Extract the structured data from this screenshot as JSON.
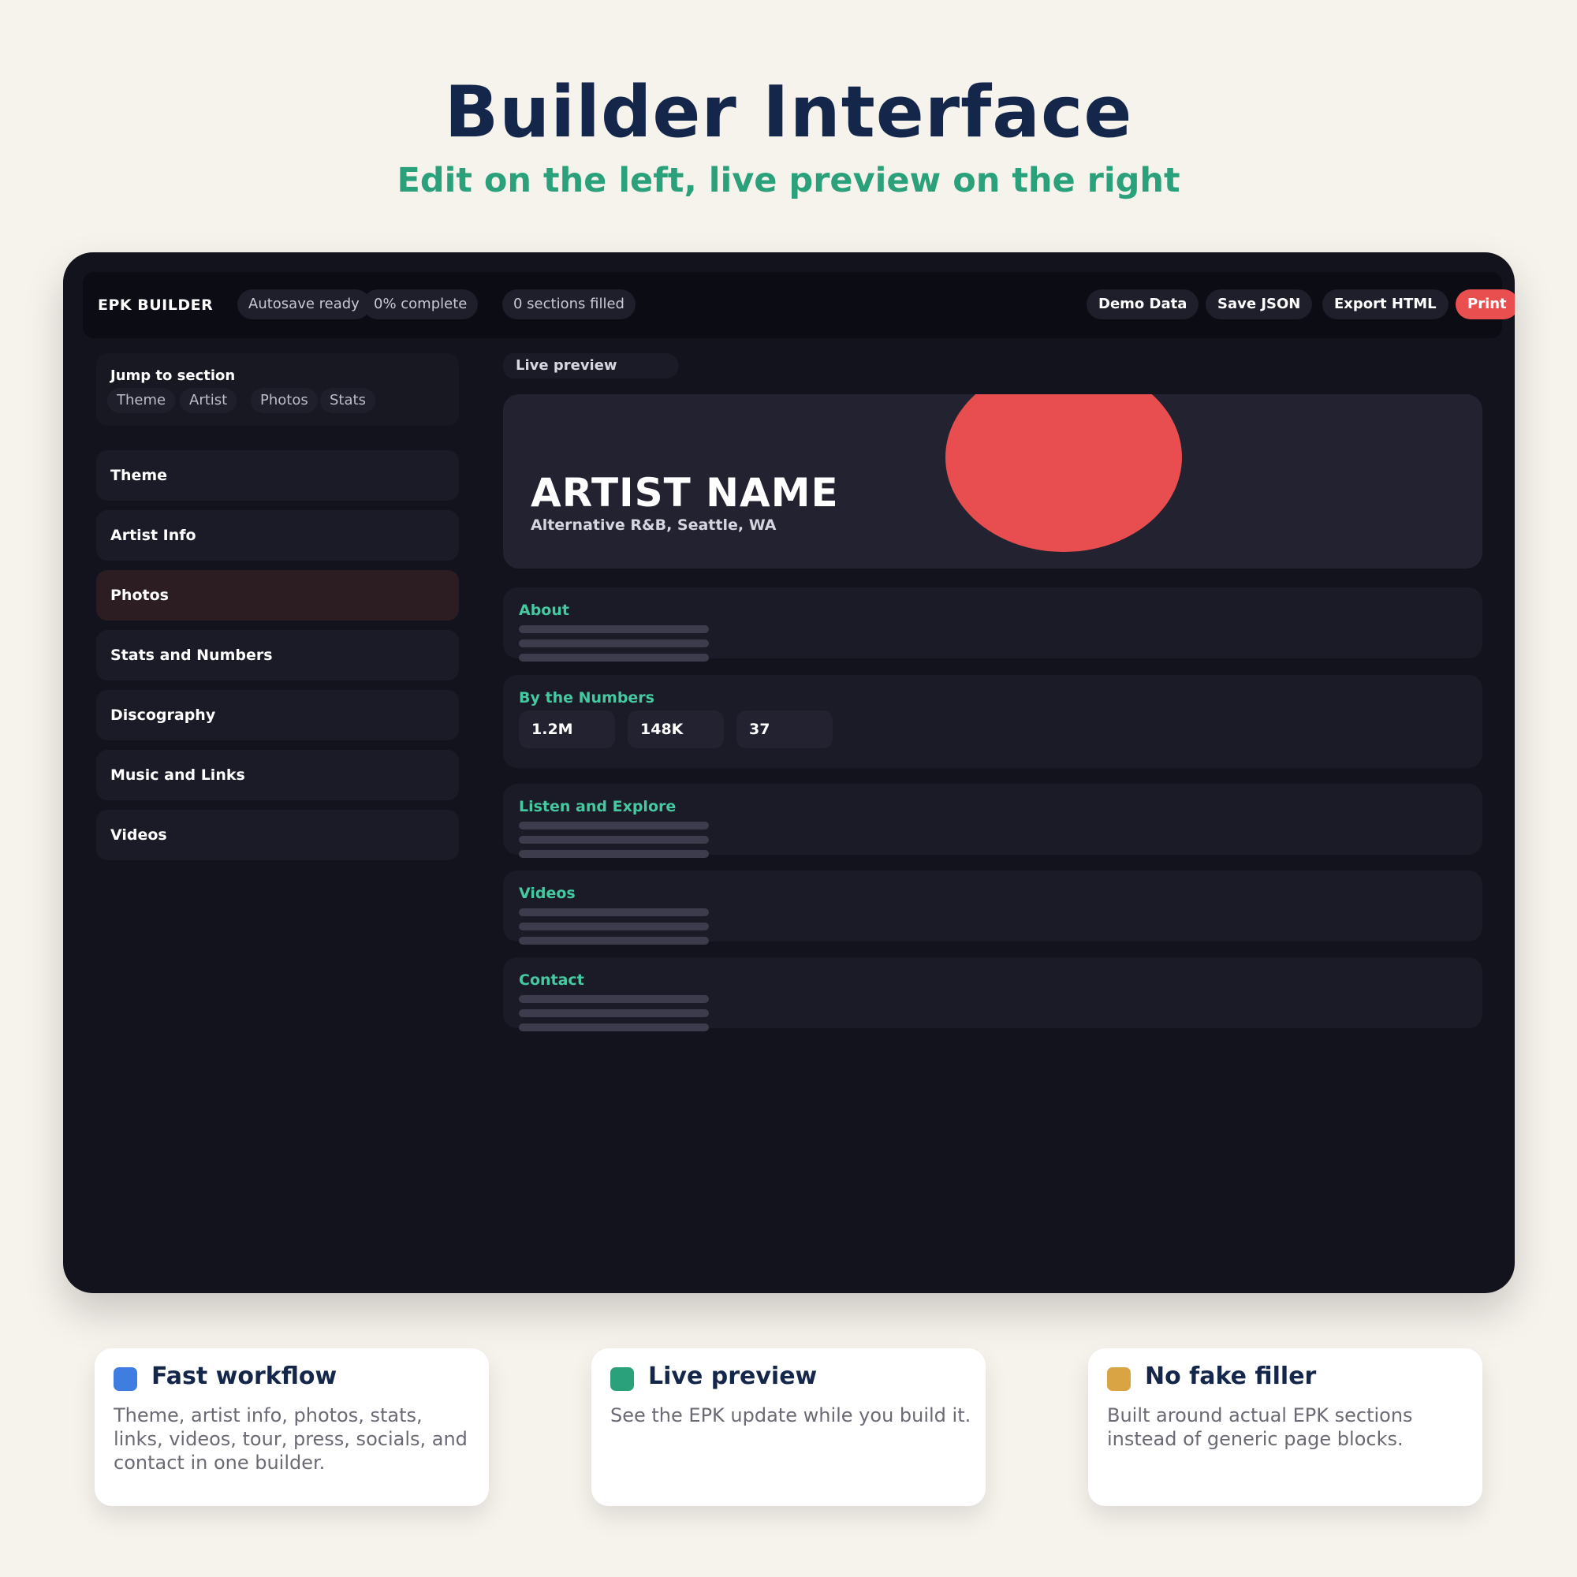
{
  "hero": {
    "title": "Builder Interface",
    "subtitle": "Edit on the left, live preview on the right"
  },
  "topbar": {
    "brand": "EPK BUILDER",
    "status_pills": [
      "Autosave ready",
      "0% complete",
      "0 sections filled"
    ],
    "buttons": {
      "demo": "Demo Data",
      "save": "Save JSON",
      "export": "Export HTML",
      "print": "Print"
    }
  },
  "sidebar": {
    "jump_title": "Jump to section",
    "jump_links": [
      "Theme",
      "Artist",
      "Photos",
      "Stats"
    ],
    "items": [
      {
        "label": "Theme",
        "active": false
      },
      {
        "label": "Artist Info",
        "active": false
      },
      {
        "label": "Photos",
        "active": true
      },
      {
        "label": "Stats and Numbers",
        "active": false
      },
      {
        "label": "Discography",
        "active": false
      },
      {
        "label": "Music and Links",
        "active": false
      },
      {
        "label": "Videos",
        "active": false
      }
    ]
  },
  "preview": {
    "label": "Live preview",
    "artist_name": "ARTIST NAME",
    "artist_meta": "Alternative R&B, Seattle, WA",
    "sections": {
      "about": "About",
      "numbers": "By the Numbers",
      "listen": "Listen and Explore",
      "videos": "Videos",
      "contact": "Contact"
    },
    "stats": [
      "1.2M",
      "148K",
      "37"
    ]
  },
  "features": [
    {
      "title": "Fast workflow",
      "desc": "Theme, artist info, photos, stats, links, videos, tour, press, socials, and contact in one builder.",
      "color": "#3f7de0"
    },
    {
      "title": "Live preview",
      "desc": "See the EPK update while you build it.",
      "color": "#2aa17a"
    },
    {
      "title": "No fake filler",
      "desc": "Built around actual EPK sections instead of generic page blocks.",
      "color": "#d8a444"
    }
  ],
  "colors": {
    "accent_red": "#e94f4f",
    "accent_green": "#45c9a1",
    "navy": "#14274a",
    "window_bg": "#13131d"
  }
}
